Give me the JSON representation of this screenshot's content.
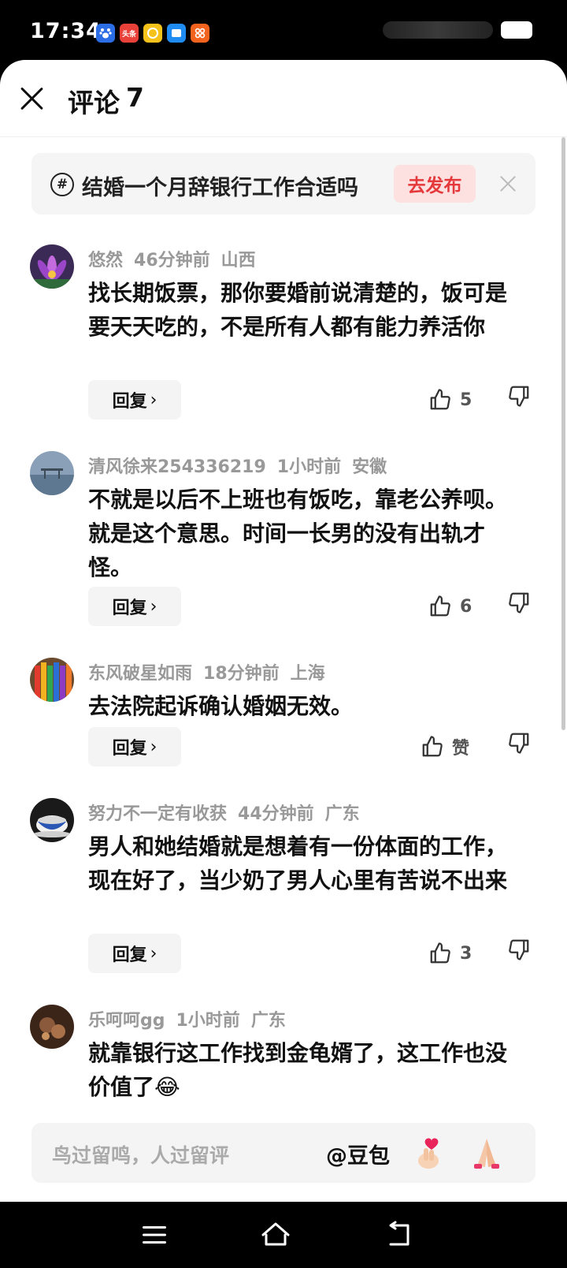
{
  "status_bar": {
    "time": "17:34",
    "app_icons": [
      "baidu-icon",
      "toutiao-icon",
      "yellow-app-icon",
      "blue-app-icon",
      "orange-app-icon"
    ],
    "app_label_toutiao": "头条"
  },
  "header": {
    "title": "评论",
    "count": "7"
  },
  "topic": {
    "icon": "#",
    "text": "结婚一个月辞银行工作合适吗",
    "publish_label": "去发布"
  },
  "comments": [
    {
      "user": "悠然",
      "time": "46分钟前",
      "location": "山西",
      "text": "找长期饭票，那你要婚前说清楚的，饭可是要天天吃的，不是所有人都有能力养活你",
      "reply": "回复",
      "likes": "5"
    },
    {
      "user": "清风徐来254336219",
      "time": "1小时前",
      "location": "安徽",
      "text": "不就是以后不上班也有饭吃，靠老公养呗。就是这个意思。时间一长男的没有出轨才怪。",
      "reply": "回复",
      "likes": "6"
    },
    {
      "user": "东风破星如雨",
      "time": "18分钟前",
      "location": "上海",
      "text": "去法院起诉确认婚姻无效。",
      "reply": "回复",
      "likes": "赞"
    },
    {
      "user": "努力不一定有收获",
      "time": "44分钟前",
      "location": "广东",
      "text": "男人和她结婚就是想着有一份体面的工作，现在好了，当少奶了男人心里有苦说不出来",
      "reply": "回复",
      "likes": "3"
    },
    {
      "user": "乐呵呵gg",
      "time": "1小时前",
      "location": "广东",
      "text": "就靠银行这工作找到金龟婿了，这工作也没价值了😂",
      "reply": "回复",
      "likes": ""
    }
  ],
  "input": {
    "placeholder": "鸟过留鸣，人过留评",
    "mention": "@豆包"
  },
  "colors": {
    "accent": "#e5383b",
    "accent_bg": "#fde1e1",
    "meta": "#999999",
    "surface": "#f4f4f4"
  }
}
